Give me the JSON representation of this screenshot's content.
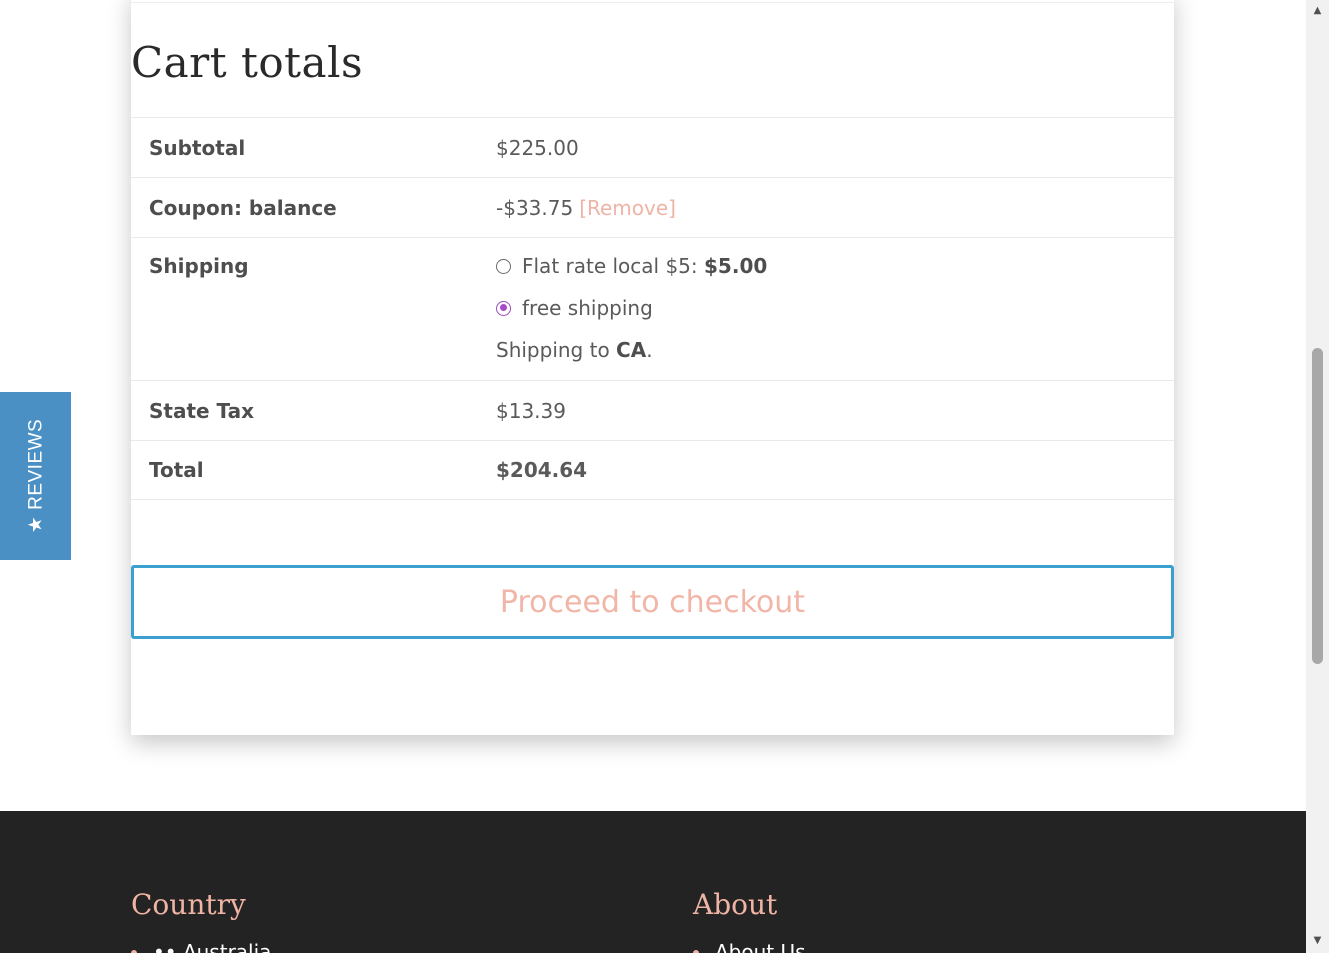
{
  "cart": {
    "title": "Cart totals",
    "subtotal": {
      "label": "Subtotal",
      "value": "$225.00"
    },
    "coupon": {
      "label": "Coupon: balance",
      "value": "-$33.75",
      "remove_label": "[Remove]"
    },
    "shipping": {
      "label": "Shipping",
      "options": [
        {
          "label": "Flat rate local $5:",
          "price": "$5.00",
          "selected": false
        },
        {
          "label": "free shipping",
          "price": "",
          "selected": true
        }
      ],
      "destination_prefix": "Shipping to",
      "destination": "CA",
      "destination_suffix": "."
    },
    "tax": {
      "label": "State Tax",
      "value": "$13.39"
    },
    "total": {
      "label": "Total",
      "value": "$204.64"
    },
    "checkout_label": "Proceed to checkout"
  },
  "reviews_tab": {
    "icon": "star-icon",
    "star": "★",
    "label": "REVIEWS",
    "color": "#4a90c4"
  },
  "footer": {
    "columns": [
      {
        "heading": "Country",
        "items": [
          "Australia"
        ],
        "item_prefix": "••"
      },
      {
        "heading": "About",
        "items": [
          "About Us"
        ]
      }
    ]
  },
  "colors": {
    "accent_pink": "#f0b4a5",
    "button_border": "#3b9fcf",
    "radio_selected": "#a94bc8",
    "footer_bg": "#232323"
  }
}
